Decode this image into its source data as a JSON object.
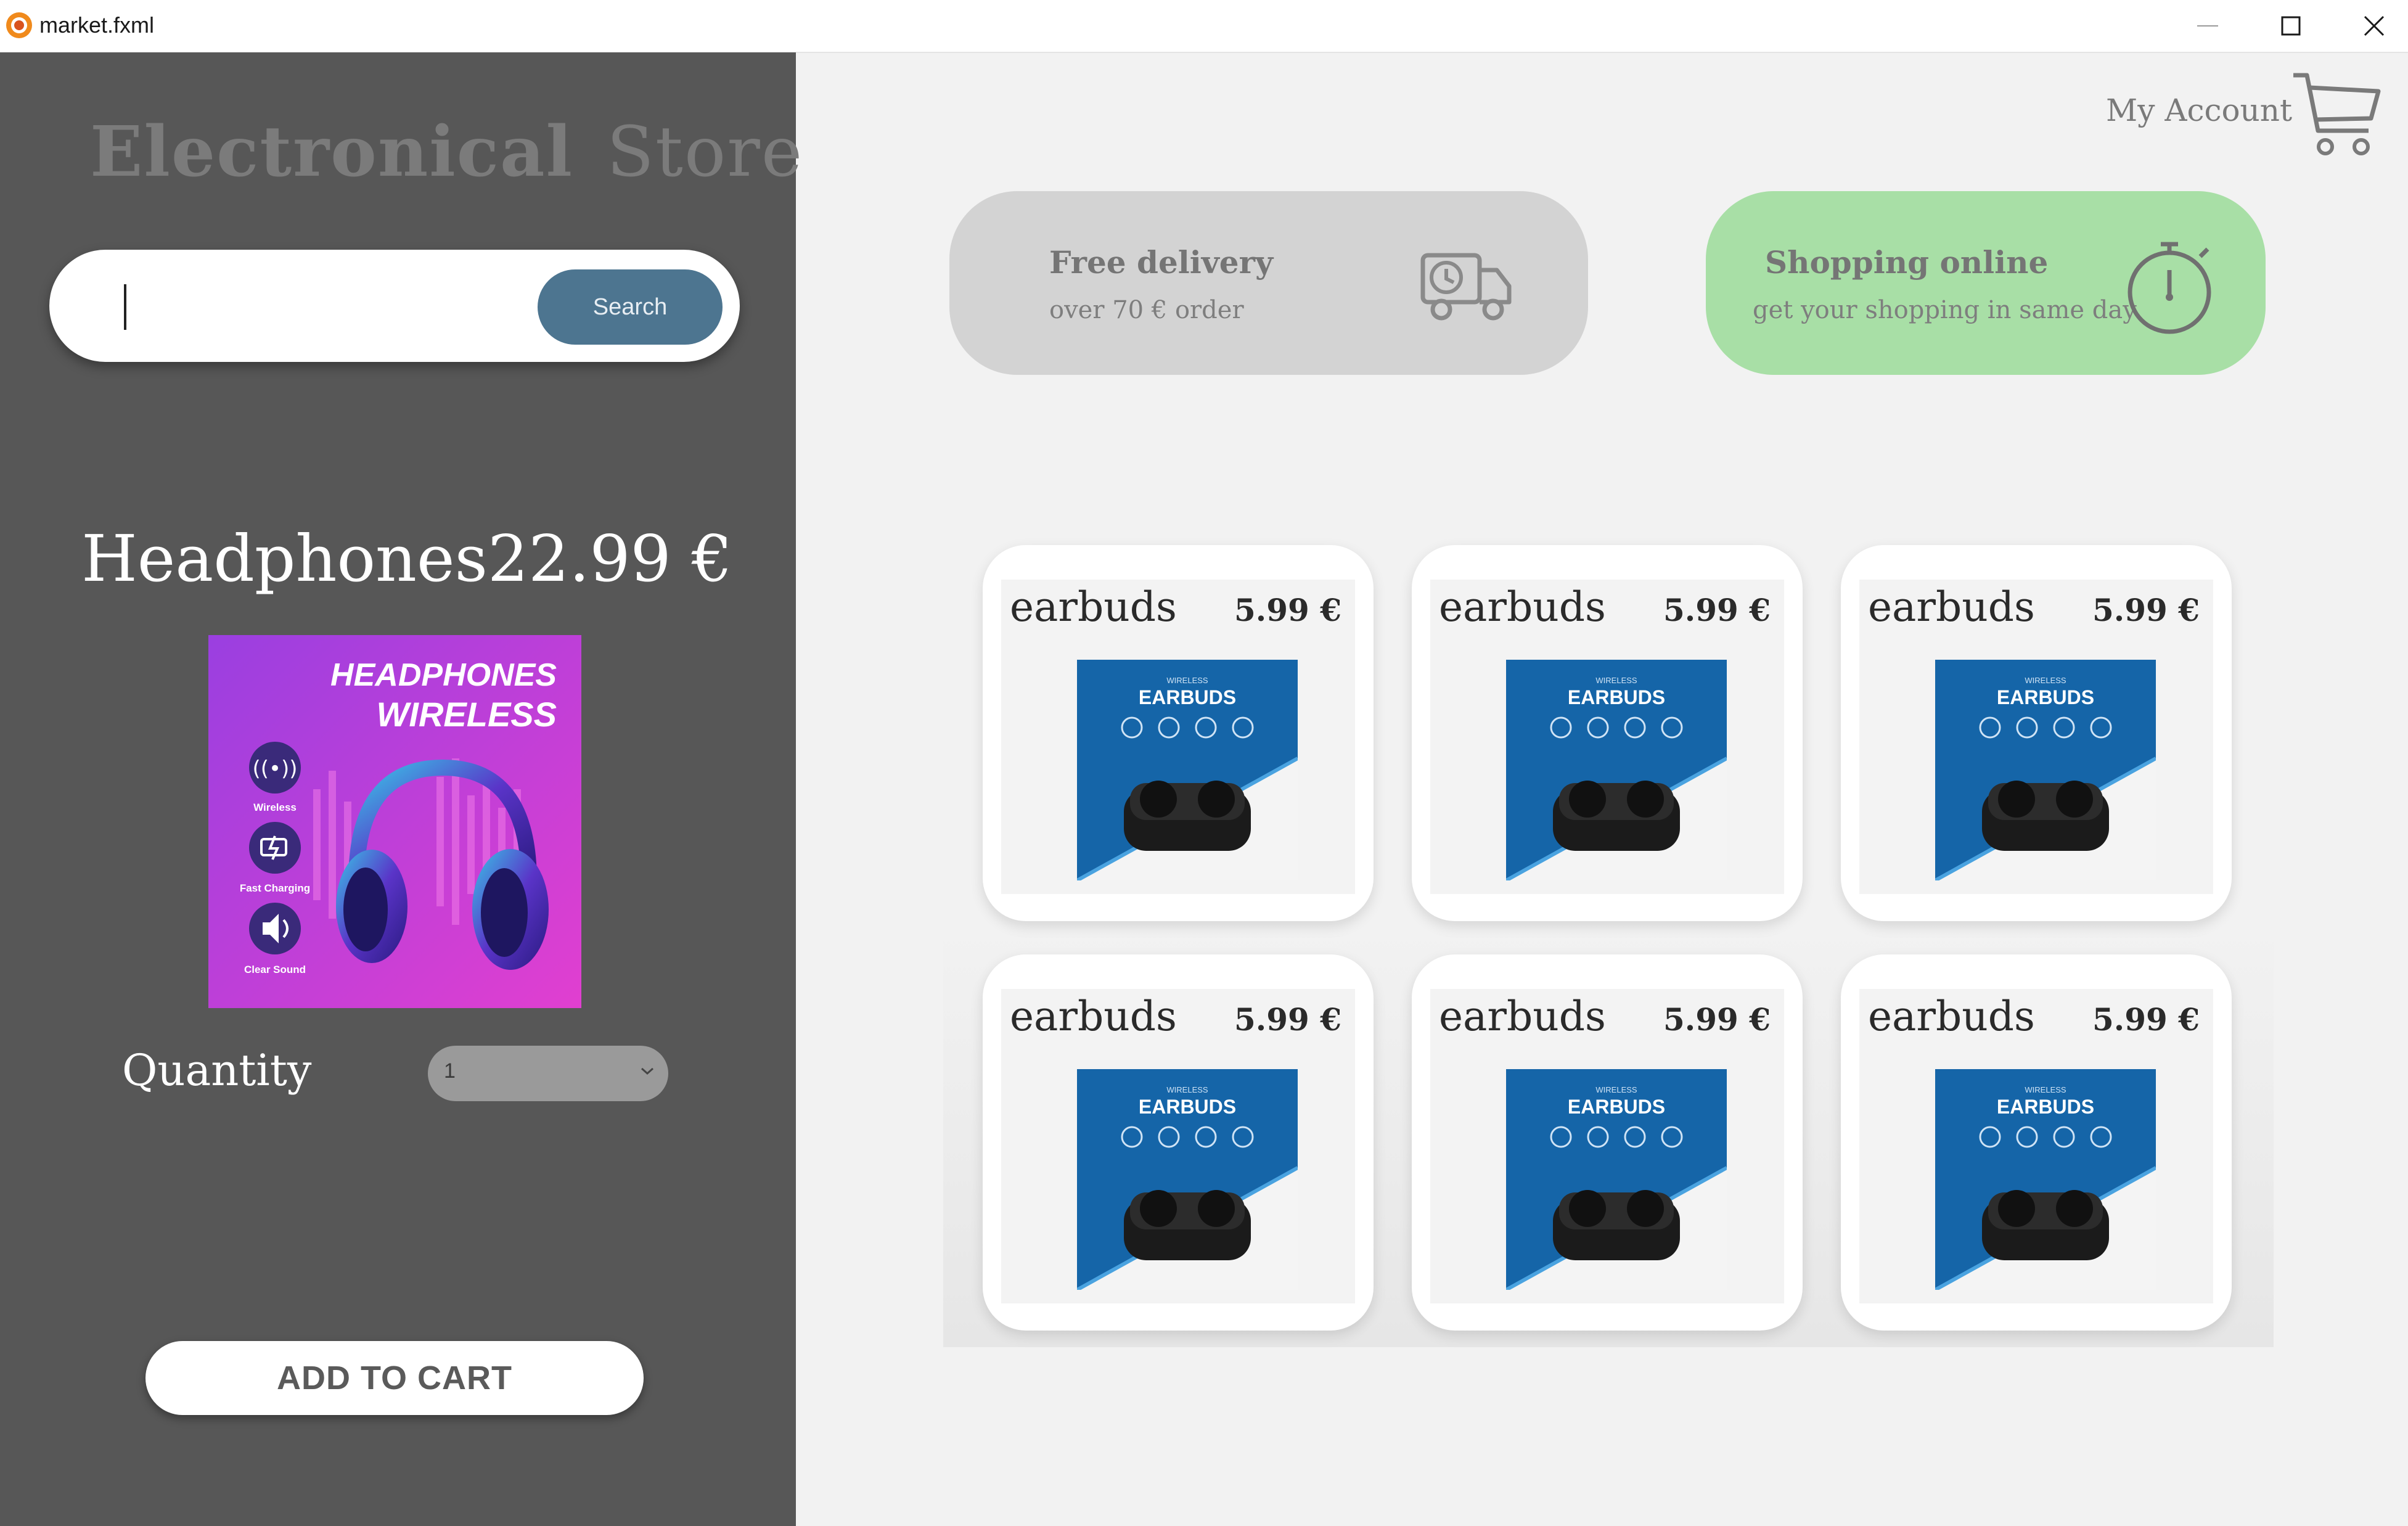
{
  "window": {
    "title": "market.fxml",
    "controls": [
      "minimize-icon",
      "maximize-icon",
      "close-icon"
    ]
  },
  "sidebar": {
    "store_title_1": "Electronical",
    "store_title_2": "Store",
    "search": {
      "value": "",
      "button_label": "Search"
    },
    "selected_product": {
      "name": "Headphones",
      "price": "22.99 €",
      "image": {
        "line1": "HEADPHONES",
        "line2": "WIRELESS",
        "features": [
          "Wireless",
          "Fast Charging",
          "Clear Sound"
        ]
      }
    },
    "quantity": {
      "label": "Quantity",
      "selected": "1"
    },
    "add_to_cart_label": "ADD TO CART"
  },
  "header": {
    "account_label": "My Account",
    "cart_icon": "shopping-cart-icon"
  },
  "promos": [
    {
      "title": "Free delivery",
      "subtitle": "over 70 € order",
      "icon": "delivery-truck-icon"
    },
    {
      "title": "Shopping online",
      "subtitle": "get your shopping in same day",
      "icon": "stopwatch-icon"
    }
  ],
  "products": [
    {
      "name": "earbuds",
      "price": "5.99 €",
      "image_small": "WIRELESS",
      "image_label": "EARBUDS"
    },
    {
      "name": "earbuds",
      "price": "5.99 €",
      "image_small": "WIRELESS",
      "image_label": "EARBUDS"
    },
    {
      "name": "earbuds",
      "price": "5.99 €",
      "image_small": "WIRELESS",
      "image_label": "EARBUDS"
    },
    {
      "name": "earbuds",
      "price": "5.99 €",
      "image_small": "WIRELESS",
      "image_label": "EARBUDS"
    },
    {
      "name": "earbuds",
      "price": "5.99 €",
      "image_small": "WIRELESS",
      "image_label": "EARBUDS"
    },
    {
      "name": "earbuds",
      "price": "5.99 €",
      "image_small": "WIRELESS",
      "image_label": "EARBUDS"
    }
  ],
  "colors": {
    "sidebar_bg": "#575757",
    "search_button": "#4d7590",
    "promo_delivery_bg": "#d3d3d3",
    "promo_online_bg": "#a8dfa6",
    "earbuds_blue": "#1565a8"
  }
}
